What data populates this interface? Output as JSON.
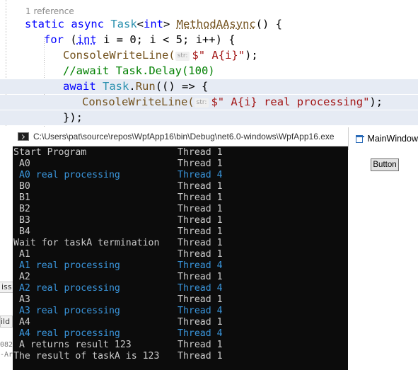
{
  "editor": {
    "reference_label": "1 reference",
    "lines": {
      "l1": {
        "a": "static",
        "b": " async ",
        "c": "Task",
        "d": "<",
        "e": "int",
        "f": "> ",
        "g": "MethodAAsync",
        "h": "() {"
      },
      "l2": {
        "a": "for",
        "b": " (",
        "c": "int",
        "d": " i = 0; i < 5; i++) {"
      },
      "l3": {
        "a": "ConsoleWriteLine(",
        "hint": "str:",
        "b": "$\" A{i}\"",
        "c": ");"
      },
      "l4": {
        "a": "//await Task.Delay(100)"
      },
      "l5": {
        "a": "await",
        "b": " ",
        "c": "Task",
        "d": ".",
        "e": "Run",
        "f": "(() => {"
      },
      "l6": {
        "a": "ConsoleWriteLine(",
        "hint": "str:",
        "b": "$\" A{i} real processing\"",
        "c": ");"
      },
      "l7": {
        "a": "});"
      }
    }
  },
  "console_window": {
    "title": "C:\\Users\\pat\\source\\repos\\WpfApp16\\bin\\Debug\\net6.0-windows\\WpfApp16.exe",
    "lines": [
      {
        "msg": "Start Program",
        "thread": "Thread 1",
        "highlight": false
      },
      {
        "msg": " A0",
        "thread": "Thread 1",
        "highlight": false
      },
      {
        "msg": " A0 real processing",
        "thread": "Thread 4",
        "highlight": true
      },
      {
        "msg": " B0",
        "thread": "Thread 1",
        "highlight": false
      },
      {
        "msg": " B1",
        "thread": "Thread 1",
        "highlight": false
      },
      {
        "msg": " B2",
        "thread": "Thread 1",
        "highlight": false
      },
      {
        "msg": " B3",
        "thread": "Thread 1",
        "highlight": false
      },
      {
        "msg": " B4",
        "thread": "Thread 1",
        "highlight": false
      },
      {
        "msg": "Wait for taskA termination",
        "thread": "Thread 1",
        "highlight": false
      },
      {
        "msg": " A1",
        "thread": "Thread 1",
        "highlight": false
      },
      {
        "msg": " A1 real processing",
        "thread": "Thread 4",
        "highlight": true
      },
      {
        "msg": " A2",
        "thread": "Thread 1",
        "highlight": false
      },
      {
        "msg": " A2 real processing",
        "thread": "Thread 4",
        "highlight": true
      },
      {
        "msg": " A3",
        "thread": "Thread 1",
        "highlight": false
      },
      {
        "msg": " A3 real processing",
        "thread": "Thread 4",
        "highlight": true
      },
      {
        "msg": " A4",
        "thread": "Thread 1",
        "highlight": false
      },
      {
        "msg": " A4 real processing",
        "thread": "Thread 4",
        "highlight": true
      },
      {
        "msg": " A returns result 123",
        "thread": "Thread 1",
        "highlight": false
      },
      {
        "msg": "The result of taskA is 123",
        "thread": "Thread 1",
        "highlight": false
      }
    ]
  },
  "wpf_window": {
    "title": "MainWindow",
    "button_label": "Button"
  },
  "background_slivers": {
    "iss": "iss",
    "ild": "ild",
    "num": "082",
    "ar": "-Ar"
  },
  "colors": {
    "console_bg": "#0c0c0c",
    "console_text": "#cccccc",
    "console_highlight": "#3a96dd",
    "keyword": "#0000ff",
    "type": "#2b91af",
    "string": "#a31515",
    "comment": "#008000"
  }
}
